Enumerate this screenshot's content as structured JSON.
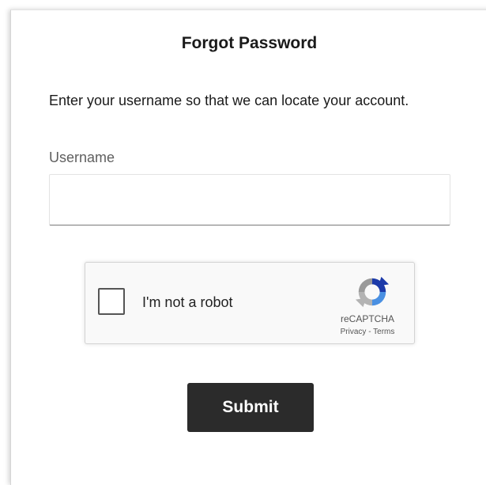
{
  "page": {
    "title": "Forgot Password",
    "instructions": "Enter your username so that we can locate your account."
  },
  "form": {
    "username_label": "Username",
    "username_value": "",
    "username_placeholder": "",
    "submit_label": "Submit"
  },
  "recaptcha": {
    "label": "I'm not a robot",
    "brand": "reCAPTCHA",
    "privacy_label": "Privacy",
    "separator": "-",
    "terms_label": "Terms",
    "checked": false,
    "logo_icon": "recaptcha-logo-icon"
  },
  "colors": {
    "button_bg": "#2b2b2b",
    "button_text": "#ffffff",
    "recaptcha_blue": "#1c3aa9",
    "recaptcha_lightblue": "#4a90e2",
    "recaptcha_gray": "#b3b3b3"
  }
}
